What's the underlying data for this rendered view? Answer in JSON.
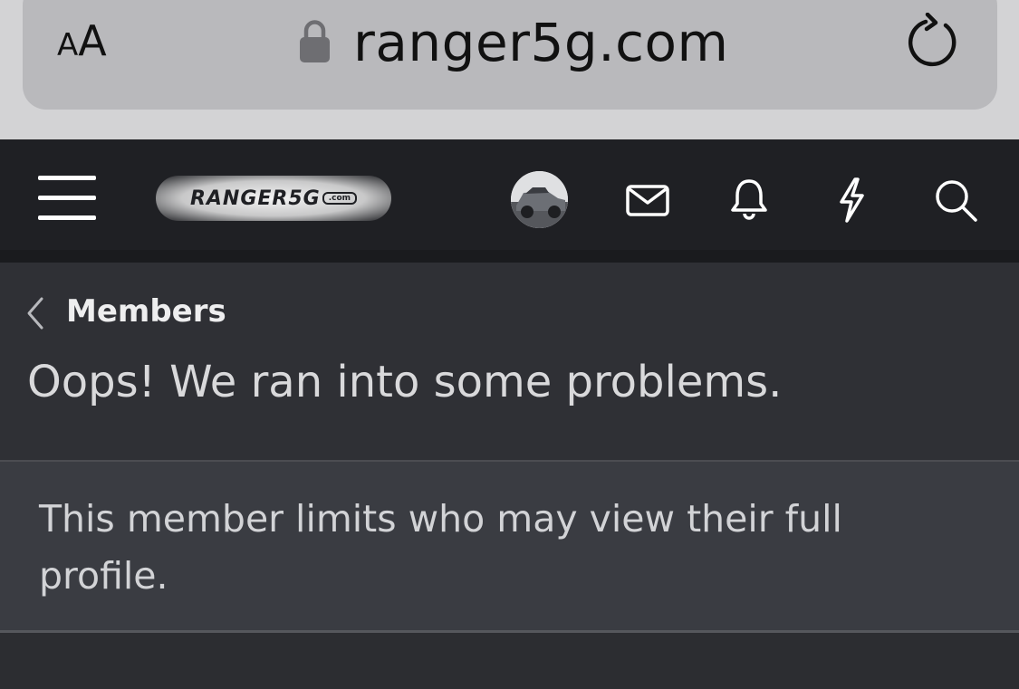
{
  "browser": {
    "text_size_small": "A",
    "text_size_big": "A",
    "url": "ranger5g.com",
    "icons": [
      "lock-icon",
      "reload-icon"
    ]
  },
  "header": {
    "logo_text": "RANGER5G",
    "logo_suffix": ".com",
    "icons": [
      "menu-icon",
      "avatar",
      "mail-icon",
      "bell-icon",
      "lightning-icon",
      "search-icon"
    ]
  },
  "breadcrumb": {
    "label": "Members"
  },
  "page": {
    "title": "Oops! We ran into some problems.",
    "message": "This member limits who may view their full profile."
  },
  "colors": {
    "header_bg": "#1f2024",
    "content_bg": "#2f3035",
    "message_bg": "#3a3c42",
    "browser_bar": "#b9b9bc"
  }
}
